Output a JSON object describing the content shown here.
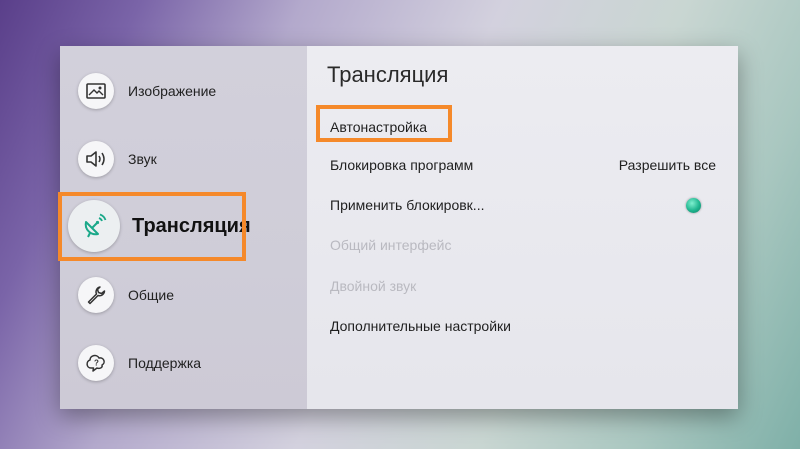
{
  "sidebar": {
    "items": [
      {
        "label": "Изображение",
        "icon": "picture-icon"
      },
      {
        "label": "Звук",
        "icon": "speaker-icon"
      },
      {
        "label": "Трансляция",
        "icon": "satellite-dish-icon",
        "active": true
      },
      {
        "label": "Общие",
        "icon": "wrench-icon"
      },
      {
        "label": "Поддержка",
        "icon": "help-bubble-icon"
      }
    ]
  },
  "content": {
    "title": "Трансляция",
    "rows": [
      {
        "label": "Автонастройка",
        "enabled": true,
        "highlighted": true
      },
      {
        "label": "Блокировка программ",
        "value": "Разрешить все",
        "enabled": true
      },
      {
        "label": "Применить блокировк...",
        "toggle": "on",
        "enabled": true
      },
      {
        "label": "Общий интерфейс",
        "enabled": false
      },
      {
        "label": "Двойной звук",
        "enabled": false
      },
      {
        "label": "Дополнительные настройки",
        "enabled": true
      }
    ]
  },
  "colors": {
    "highlight": "#f5892a",
    "toggle_on": "#1fb58f",
    "disabled_text": "#b9b9c0"
  }
}
